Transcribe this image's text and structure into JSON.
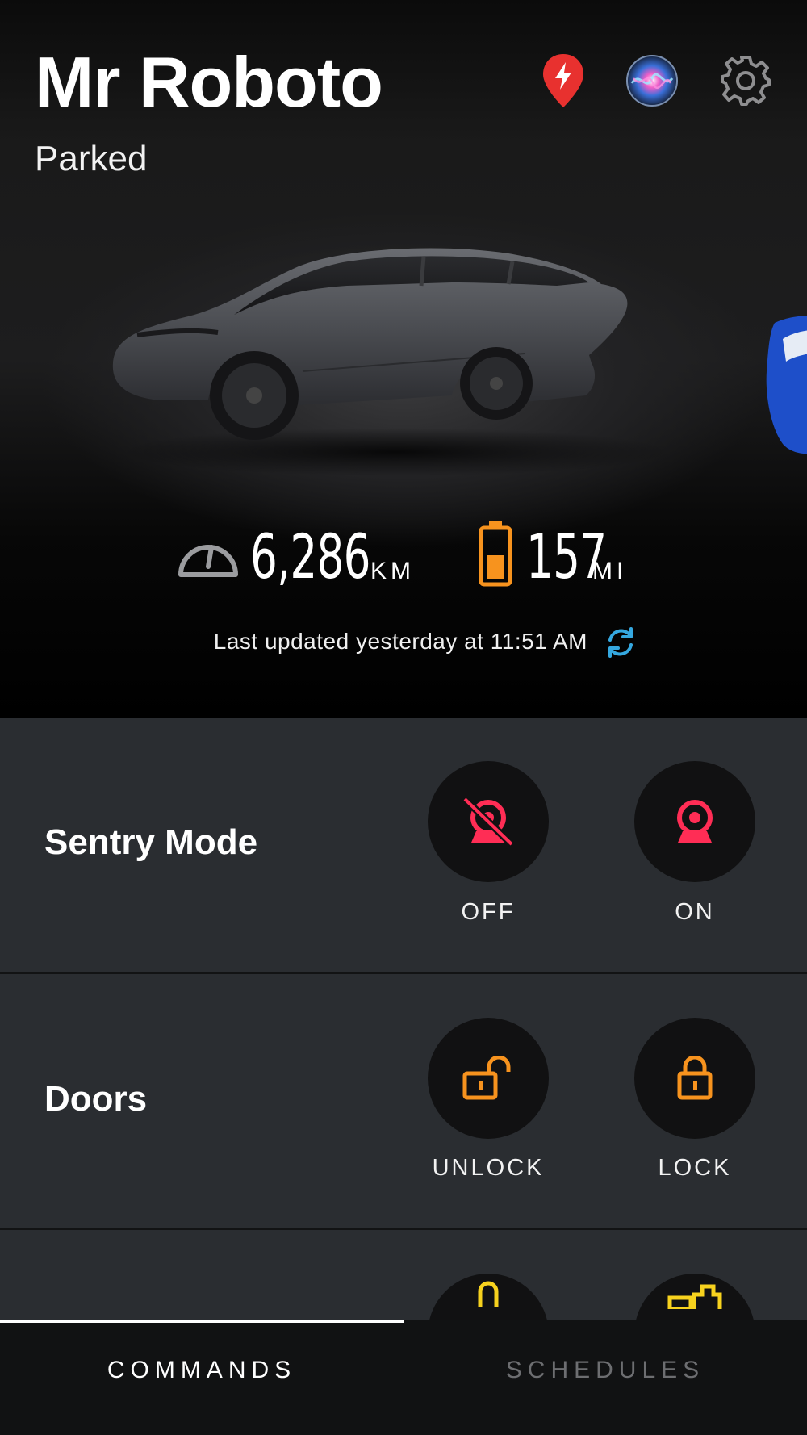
{
  "header": {
    "car_name": "Mr Roboto",
    "status": "Parked",
    "icons": [
      "supercharger-pin-icon",
      "siri-icon",
      "gear-icon"
    ]
  },
  "stats": {
    "odometer_value": "6,286",
    "odometer_unit": "KM",
    "range_value": "157",
    "range_unit": "MI",
    "last_updated": "Last updated yesterday at 11:51 AM"
  },
  "commands": [
    {
      "title": "Sentry Mode",
      "buttons": [
        {
          "label": "OFF",
          "icon": "sentry-off-icon"
        },
        {
          "label": "ON",
          "icon": "sentry-on-icon"
        }
      ]
    },
    {
      "title": "Doors",
      "buttons": [
        {
          "label": "UNLOCK",
          "icon": "unlock-icon"
        },
        {
          "label": "LOCK",
          "icon": "lock-icon"
        }
      ]
    }
  ],
  "tabs": [
    {
      "label": "COMMANDS",
      "active": true
    },
    {
      "label": "SCHEDULES",
      "active": false
    }
  ],
  "colors": {
    "sentry": "#ff2d55",
    "doors": "#f7931e",
    "battery": "#f7931e",
    "refresh": "#35a8e0",
    "pin": "#e8312f",
    "panel_bg": "#2a2d31"
  }
}
